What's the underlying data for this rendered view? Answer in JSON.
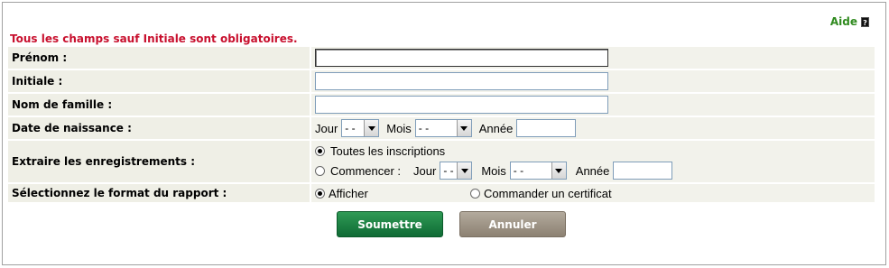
{
  "help": {
    "label": "Aide",
    "icon": "help-book-icon"
  },
  "required_note": "Tous les champs sauf Initiale sont obligatoires.",
  "fields": {
    "first_name": {
      "label": "Prénom :",
      "value": ""
    },
    "initial": {
      "label": "Initiale :",
      "value": ""
    },
    "last_name": {
      "label": "Nom de famille :",
      "value": ""
    },
    "birth_date": {
      "label": "Date de naissance :",
      "day_label": "Jour",
      "day_value": "- -",
      "month_label": "Mois",
      "month_value": "- -",
      "year_label": "Année",
      "year_value": ""
    },
    "extract": {
      "label": "Extraire les enregistrements :",
      "option_all": "Toutes les inscriptions",
      "option_start": "Commencer :",
      "selected": "all",
      "day_label": "Jour",
      "day_value": "- -",
      "month_label": "Mois",
      "month_value": "- -",
      "year_label": "Année",
      "year_value": ""
    },
    "format": {
      "label": "Sélectionnez le format du rapport :",
      "option_display": "Afficher",
      "option_certificate": "Commander un certificat",
      "selected": "display"
    }
  },
  "buttons": {
    "submit": "Soumettre",
    "cancel": "Annuler"
  },
  "colors": {
    "required": "#c8102e",
    "help": "#2f8a1e",
    "submit": "#14763a",
    "cancel": "#9e9486"
  }
}
